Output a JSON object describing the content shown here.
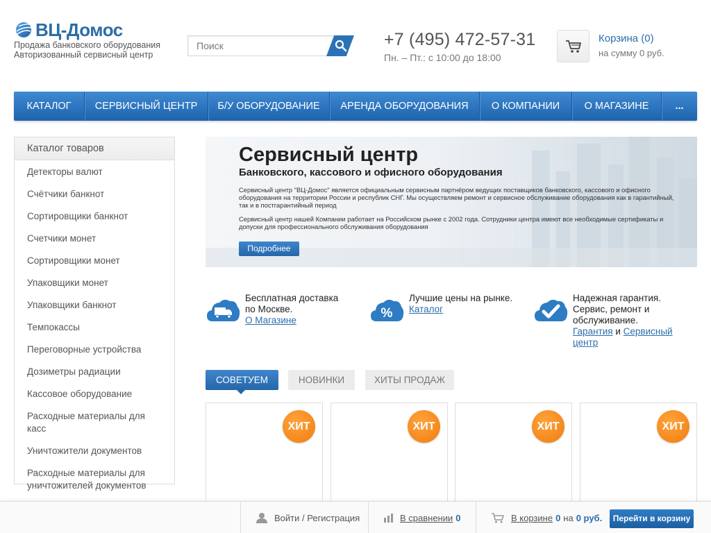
{
  "header": {
    "logo_title": "ВЦ-Домос",
    "logo_sub1": "Продажа банковского оборудования",
    "logo_sub2": "Авторизованный сервисный центр",
    "search_placeholder": "Поиск",
    "phone": "+7 (495) 472-57-31",
    "hours": "Пн. – Пт.: с 10:00 до 18:00",
    "cart_link": "Корзина (0)",
    "cart_sum": "на сумму 0 руб."
  },
  "nav": {
    "items": [
      "КАТАЛОГ",
      "СЕРВИСНЫЙ ЦЕНТР",
      "Б/У ОБОРУДОВАНИЕ",
      "АРЕНДА ОБОРУДОВАНИЯ",
      "О КОМПАНИИ",
      "О МАГАЗИНЕ",
      "..."
    ]
  },
  "sidebar": {
    "title": "Каталог товаров",
    "items": [
      "Детекторы валют",
      "Счётчики банкнот",
      "Сортировщики банкнот",
      "Счетчики монет",
      "Сортировщики монет",
      "Упаковщики монет",
      "Упаковщики банкнот",
      "Темпокассы",
      "Переговорные устройства",
      "Дозиметры радиации",
      "Кассовое оборудование",
      "Расходные материалы для касс",
      "Уничтожители документов",
      "Расходные материалы для уничтожителей документов"
    ]
  },
  "banner": {
    "title": "Сервисный центр",
    "subtitle": "Банковского, кассового и офисного оборудования",
    "para1": "Сервисный центр \"ВЦ-Домос\" является официальным сервисным партнёром ведущих поставщиков банковского, кассового и офисного оборудования на территории России и республик СНГ. Мы осуществляем ремонт и сервисное обслуживание оборудования как в гарантийный, так и в постгарантийный период",
    "para2": "Сервисный центр нашей Компании работает на Российском рынке с 2002 года. Сотрудники центра имеют все необходимые сертификаты и допуски для профессионального обслуживания оборудования",
    "button": "Подробнее"
  },
  "features": [
    {
      "icon": "delivery-truck-icon",
      "line1": "Бесплатная доставка",
      "line2": "по Москве.",
      "link1": "О Магазине"
    },
    {
      "icon": "percent-badge-icon",
      "line1": "Лучшие цены на рынке.",
      "link1": "Каталог"
    },
    {
      "icon": "checkmark-cloud-icon",
      "line1": "Надежная гарантия.",
      "line2": "Сервис, ремонт и",
      "line3": "обслуживание.",
      "link1": "Гарантия",
      "conj": "и",
      "link2a": "Сервисный",
      "link2b": "центр"
    }
  ],
  "tabs": [
    "СОВЕТУЕМ",
    "НОВИНКИ",
    "ХИТЫ ПРОДАЖ"
  ],
  "cards": [
    {
      "badge": "ХИТ"
    },
    {
      "badge": "ХИТ"
    },
    {
      "badge": "ХИТ"
    },
    {
      "badge": "ХИТ"
    }
  ],
  "bottom_bar": {
    "login": "Войти / Регистрация",
    "compare_label": "В сравнении",
    "compare_count": "0",
    "cart_label": "В корзине",
    "cart_count": "0",
    "cart_on": "на",
    "cart_sum": "0 руб.",
    "cart_button": "Перейти в корзину"
  },
  "colors": {
    "brand_blue": "#2d6da7",
    "nav_blue": "#2a6fb8",
    "hit_orange": "#f5881f",
    "link_blue": "#2a6eae"
  }
}
